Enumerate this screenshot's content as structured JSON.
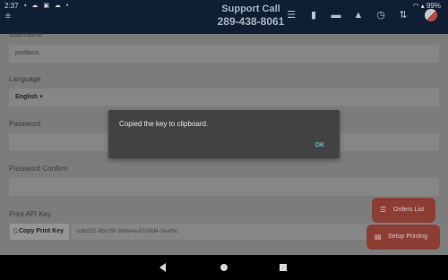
{
  "status_bar": {
    "time": "2:37",
    "notification_icons": "▪ ☁ ▣ ☁ •",
    "battery": "99%"
  },
  "header": {
    "menu_icon": "hamburger-icon",
    "support_title": "Support Call",
    "support_phone": "289-438-8061",
    "nav_icons": [
      "list-icon",
      "book-icon",
      "card-icon",
      "graduation-cap-icon",
      "clock-icon",
      "sort-icon",
      "avatar"
    ]
  },
  "form": {
    "username_label": "Username",
    "username_value": "portlions",
    "language_label": "Language",
    "language_value": "English",
    "password_label": "Password",
    "password_confirm_label": "Password Confirm",
    "print_api_key_label": "Print API Key",
    "copy_button_label": "Copy Print Key",
    "print_api_key_value": "cdb232-8bc29f-388e4a-6539d4-2eaf8c"
  },
  "fabs": {
    "orders_list": "Orders List",
    "setup_printing": "Setup Printing"
  },
  "dialog": {
    "message": "Copied the key to clipboard.",
    "ok_label": "OK"
  },
  "colors": {
    "app_bar": "#0f1e33",
    "accent_button": "#c0392b",
    "dialog_bg": "#424242",
    "dialog_ok": "#80cbc4"
  }
}
